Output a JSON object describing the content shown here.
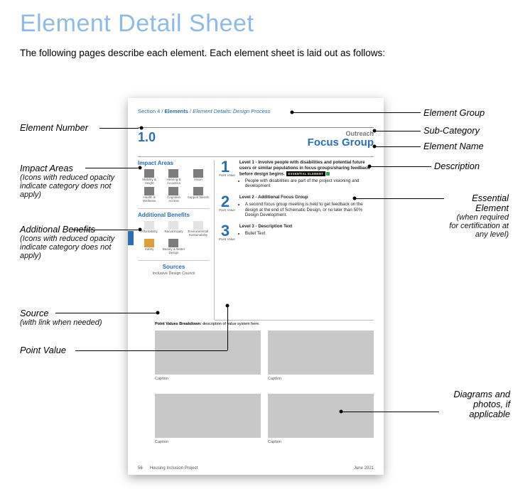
{
  "page": {
    "title": "Element Detail Sheet",
    "intro": "The following pages describe each element.  Each element sheet is laid out as follows:"
  },
  "breadcrumb": {
    "section": "Section 4",
    "part": "Elements",
    "detail": "Element Details: Design Process"
  },
  "element": {
    "number": "1.0",
    "subcategory": "Outreach",
    "name": "Focus Group"
  },
  "impactAreas": {
    "heading": "Impact Areas",
    "items": [
      {
        "label": "Mobility & Height"
      },
      {
        "label": "Hearing & Acoustics"
      },
      {
        "label": "Vision"
      },
      {
        "label": "Health & Wellness"
      },
      {
        "label": "Cognitive Access"
      },
      {
        "label": "Support Needs"
      }
    ]
  },
  "additionalBenefits": {
    "heading": "Additional Benefits",
    "items": [
      {
        "label": "Affordability",
        "dim": true
      },
      {
        "label": "Racial Equity",
        "dim": true
      },
      {
        "label": "Environmental Sustainability",
        "dim": true
      },
      {
        "label": "Safety",
        "dim": false
      },
      {
        "label": "Beauty & Better Design",
        "dim": false
      }
    ]
  },
  "sources": {
    "heading": "Sources",
    "text": "Inclusive Design Council"
  },
  "levels": [
    {
      "num": "1",
      "pv": "Point Value",
      "heading": "Level 1 - Involve people with disabilities and potential future users or similar populations in focus groups/sharing feedback before design begins.",
      "essential": true,
      "essential_label": "ESSENTIAL ELEMENT",
      "bullets": [
        "People with disabilities are part of the project visioning and development"
      ]
    },
    {
      "num": "2",
      "pv": "Point Value",
      "heading": "Level 2 - Additional Focus Group",
      "essential": false,
      "bullets": [
        "A second focus group meeting is held to get feedback on the design at the end of Schematic Design, or no later than 50% Design Development."
      ]
    },
    {
      "num": "3",
      "pv": "Point Value",
      "heading": "Level 3 - Description Text",
      "essential": false,
      "bullets": [
        "Bullet Text"
      ]
    }
  ],
  "breakdown": {
    "label": "Point Values Breakdown:",
    "text": " description of value system here."
  },
  "captions": [
    "Caption",
    "Caption",
    "Caption",
    "Caption"
  ],
  "footer": {
    "page": "56",
    "project": "Housing Inclusion Project",
    "date": "June 2021"
  },
  "callouts": {
    "elementNumber": "Element Number",
    "impactAreas": "Impact Areas",
    "impactAreasSub": "(Icons with reduced opacity indicate category does not apply)",
    "additionalBenefits": "Additional Benefits",
    "additionalBenefitsSub": "(Icons with reduced opacity indicate category does not apply)",
    "source": "Source",
    "sourceSub": "(with link when needed)",
    "pointValue": "Point Value",
    "elementGroup": "Element Group",
    "subCategory": "Sub-Category",
    "elementName": "Element Name",
    "description": "Description",
    "essentialElement": "Essential Element",
    "essentialElementSub": "(when required for certification at any level)",
    "diagrams": "Diagrams and photos, if applicable"
  }
}
